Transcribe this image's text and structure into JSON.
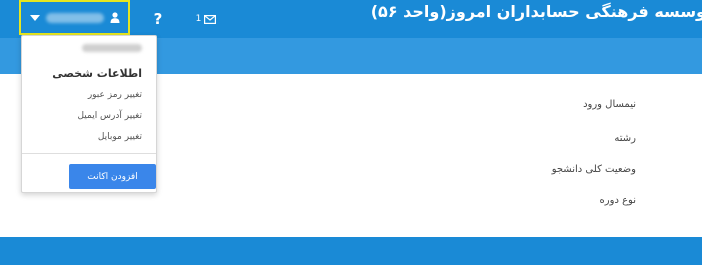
{
  "header": {
    "title": "وسسه فرهنگی حسابداران امروز(واحد ۵۶)",
    "help_label": "?",
    "inbox_count": "1",
    "inbox_icon": "envelope-icon",
    "user_icon": "user-icon"
  },
  "user_menu": {
    "heading": "اطلاعات شخصی",
    "items": [
      {
        "label": "تغییر رمز عبور"
      },
      {
        "label": "تغییر آدرس ایمیل"
      },
      {
        "label": "تغییر موبایل"
      }
    ],
    "button_label": "افزودن اکانت"
  },
  "profile_fields": [
    {
      "label": "نیمسال ورود"
    },
    {
      "label": "رشته"
    },
    {
      "label": "وضعیت کلی دانشجو"
    },
    {
      "label": "نوع دوره"
    }
  ],
  "colors": {
    "header": "#1a8ad6",
    "subheader": "#3399e0",
    "highlight_border": "#e6e61f",
    "button": "#3a86ea"
  }
}
